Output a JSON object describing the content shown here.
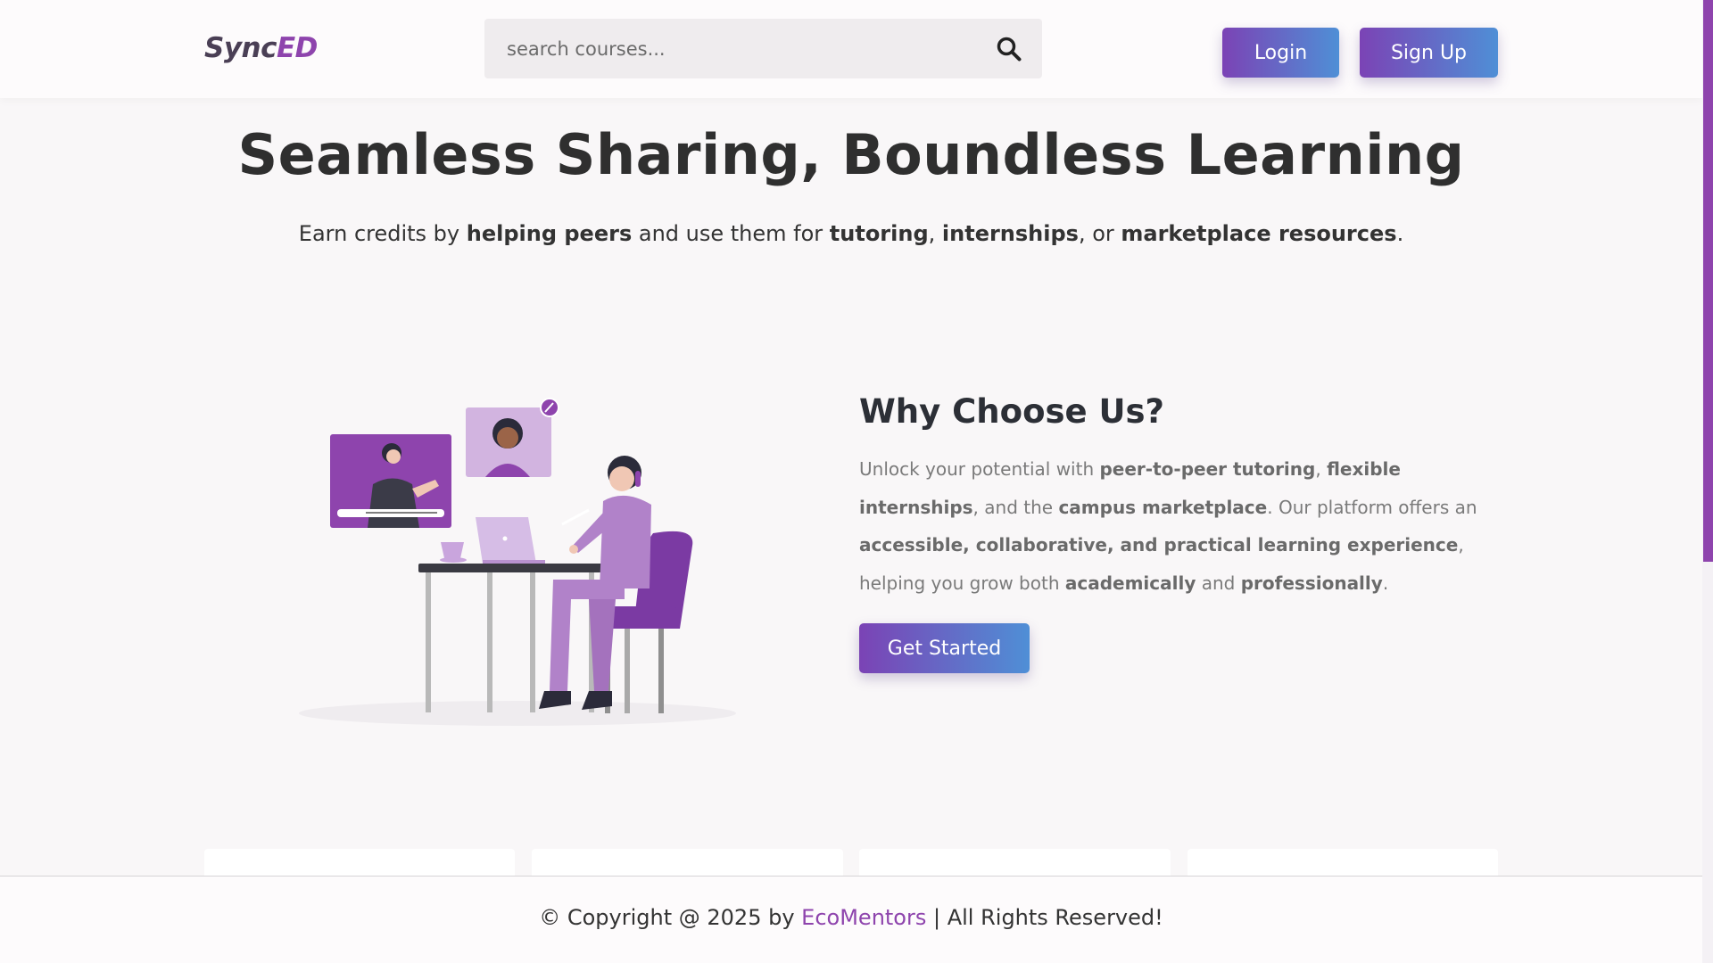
{
  "header": {
    "logo_part1": "Sync",
    "logo_part2": "ED",
    "search_placeholder": "search courses...",
    "login_label": "Login",
    "signup_label": "Sign Up"
  },
  "hero": {
    "title": "Seamless Sharing, Boundless Learning",
    "sub_1": "Earn credits by ",
    "sub_b1": "helping peers",
    "sub_2": " and use them for ",
    "sub_b2": "tutoring",
    "sub_3": ", ",
    "sub_b3": "internships",
    "sub_4": ", or ",
    "sub_b4": "marketplace resources",
    "sub_5": "."
  },
  "why": {
    "title": "Why Choose Us?",
    "t1": "Unlock your potential with ",
    "b1": "peer-to-peer tutoring",
    "t2": ", ",
    "b2": "flexible internships",
    "t3": ", and the ",
    "b3": "campus marketplace",
    "t4": ". Our platform offers an ",
    "b4": "accessible, collaborative, and practical learning experience",
    "t5": ", helping you grow both ",
    "b5": "academically",
    "t6": " and ",
    "b6": "professionally",
    "t7": ".",
    "cta_label": "Get Started"
  },
  "footer": {
    "prefix": "© Copyright @ 2025 by ",
    "link": "EcoMentors",
    "suffix": " | All Rights Reserved!"
  },
  "colors": {
    "brand_purple": "#8e44ad",
    "gradient_start": "#7b43b5",
    "gradient_end": "#4f8fd6"
  }
}
